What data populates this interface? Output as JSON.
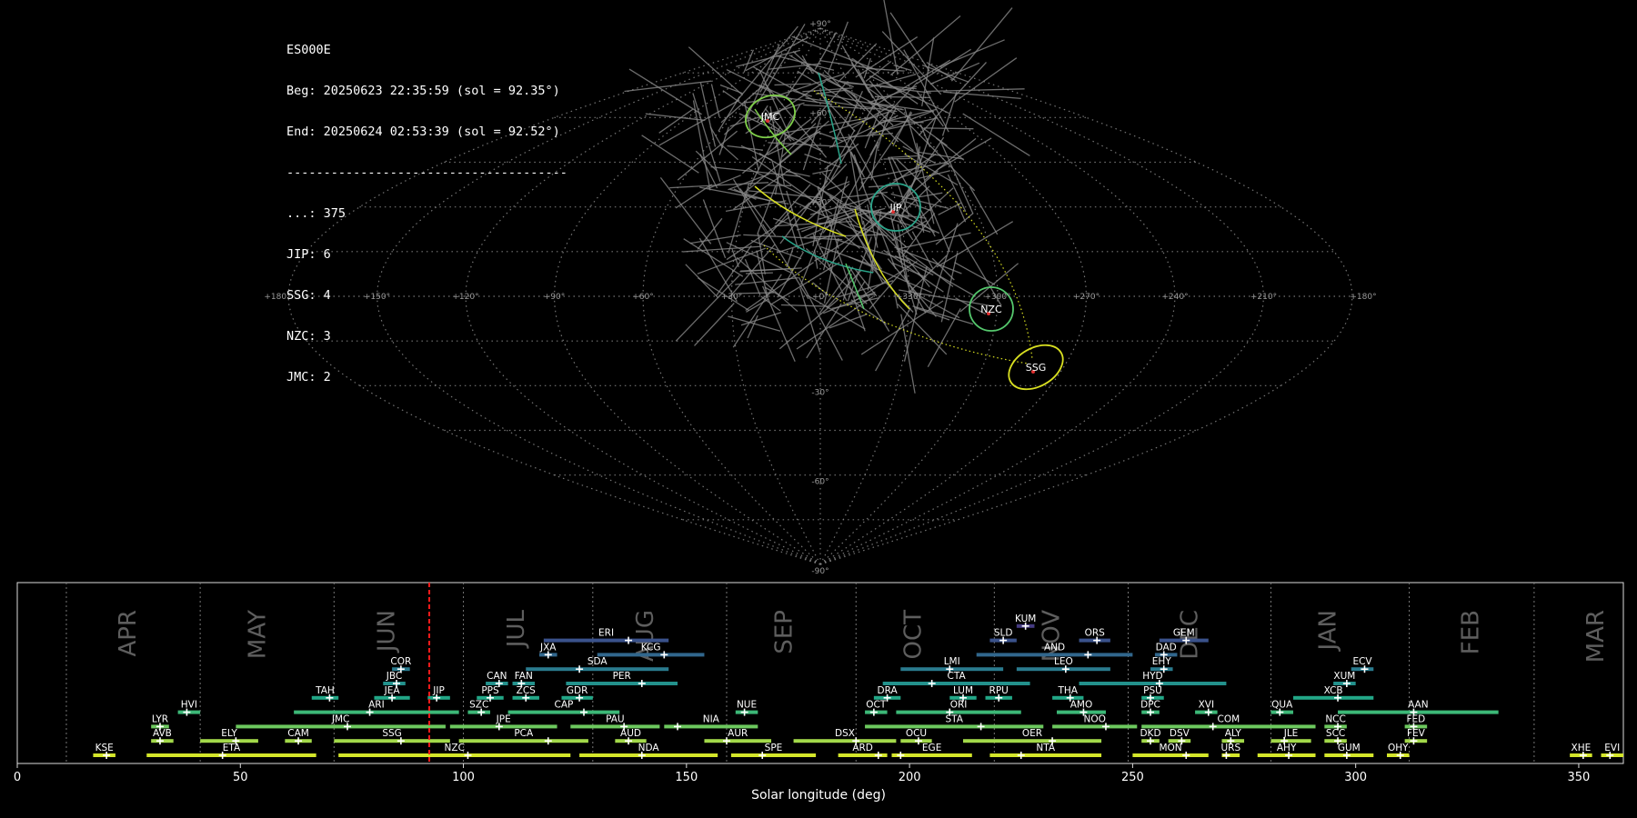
{
  "info": {
    "station": "ES000E",
    "begin": "Beg: 20250623 22:35:59 (sol = 92.35°)",
    "end": "End: 20250624 02:53:39 (sol = 92.52°)",
    "separator": "--------------------------------------",
    "counts": [
      {
        "label": "...: 375"
      },
      {
        "label": "JIP: 6"
      },
      {
        "label": "SSG: 4"
      },
      {
        "label": "NZC: 3"
      },
      {
        "label": "JMC: 2"
      }
    ]
  },
  "sky_map": {
    "projection": "sinusoidal",
    "lon_labels": [
      "+180°",
      "+150°",
      "+120°",
      "+90°",
      "+60°",
      "+30°",
      "+0°",
      "+330°",
      "+300°",
      "+270°",
      "+240°",
      "+210°",
      "+180°"
    ],
    "lat_labels": [
      "+90°",
      "+60°",
      "+30°",
      "+0°",
      "-30°",
      "-60°",
      "-90°"
    ],
    "showers": [
      {
        "code": "JMC",
        "color": "#7fcf4a"
      },
      {
        "code": "JIP",
        "color": "#2aa58a"
      },
      {
        "code": "NZC",
        "color": "#55c86d"
      },
      {
        "code": "SSG",
        "color": "#d9e021"
      }
    ],
    "sporadic_color": "#888888"
  },
  "chart_data": {
    "type": "timeline",
    "xlabel": "Solar longitude (deg)",
    "xlim": [
      0,
      360
    ],
    "xticks": [
      0,
      50,
      100,
      150,
      200,
      250,
      300,
      350
    ],
    "current_sol": 92.35,
    "months": [
      {
        "name": "APR",
        "sol": 25
      },
      {
        "name": "MAY",
        "sol": 54
      },
      {
        "name": "JUN",
        "sol": 83
      },
      {
        "name": "JUL",
        "sol": 112
      },
      {
        "name": "AUG",
        "sol": 141
      },
      {
        "name": "SEP",
        "sol": 172
      },
      {
        "name": "OCT",
        "sol": 201
      },
      {
        "name": "NOV",
        "sol": 232
      },
      {
        "name": "DEC",
        "sol": 263
      },
      {
        "name": "JAN",
        "sol": 294
      },
      {
        "name": "FEB",
        "sol": 326
      },
      {
        "name": "MAR",
        "sol": 354
      }
    ],
    "month_boundaries": [
      11,
      41,
      71,
      100,
      129,
      159,
      188,
      219,
      249,
      281,
      312,
      340
    ],
    "showers": [
      {
        "code": "KUM",
        "start": 224,
        "end": 228,
        "peak": 226,
        "row": 10
      },
      {
        "code": "ERI",
        "start": 118,
        "end": 146,
        "peak": 137,
        "row": 9
      },
      {
        "code": "SLD",
        "start": 218,
        "end": 224,
        "peak": 221,
        "row": 9
      },
      {
        "code": "ORS",
        "start": 238,
        "end": 245,
        "peak": 242,
        "row": 9
      },
      {
        "code": "GEM",
        "start": 256,
        "end": 267,
        "peak": 262,
        "row": 9
      },
      {
        "code": "JXA",
        "start": 117,
        "end": 121,
        "peak": 119,
        "row": 8
      },
      {
        "code": "KCG",
        "start": 130,
        "end": 154,
        "peak": 145,
        "row": 8
      },
      {
        "code": "AND",
        "start": 215,
        "end": 250,
        "peak": 240,
        "row": 8
      },
      {
        "code": "DAD",
        "start": 255,
        "end": 260,
        "peak": 257,
        "row": 8
      },
      {
        "code": "COR",
        "start": 84,
        "end": 88,
        "peak": 86,
        "row": 7
      },
      {
        "code": "SDA",
        "start": 114,
        "end": 146,
        "peak": 126,
        "row": 7
      },
      {
        "code": "LMI",
        "start": 198,
        "end": 221,
        "peak": 209,
        "row": 7
      },
      {
        "code": "LEO",
        "start": 224,
        "end": 245,
        "peak": 235,
        "row": 7
      },
      {
        "code": "EHY",
        "start": 254,
        "end": 259,
        "peak": 257,
        "row": 7
      },
      {
        "code": "ECV",
        "start": 299,
        "end": 304,
        "peak": 302,
        "row": 7
      },
      {
        "code": "JBC",
        "start": 82,
        "end": 87,
        "peak": 85,
        "row": 6
      },
      {
        "code": "CAN",
        "start": 105,
        "end": 110,
        "peak": 108,
        "row": 6
      },
      {
        "code": "FAN",
        "start": 111,
        "end": 116,
        "peak": 113,
        "row": 6
      },
      {
        "code": "PER",
        "start": 123,
        "end": 148,
        "peak": 140,
        "row": 6
      },
      {
        "code": "CTA",
        "start": 194,
        "end": 227,
        "peak": 205,
        "row": 6
      },
      {
        "code": "HYD",
        "start": 238,
        "end": 271,
        "peak": 256,
        "row": 6
      },
      {
        "code": "XUM",
        "start": 295,
        "end": 300,
        "peak": 298,
        "row": 6
      },
      {
        "code": "TAH",
        "start": 66,
        "end": 72,
        "peak": 70,
        "row": 5
      },
      {
        "code": "JEA",
        "start": 80,
        "end": 88,
        "peak": 84,
        "row": 5
      },
      {
        "code": "JIP",
        "start": 92,
        "end": 97,
        "peak": 94,
        "row": 5
      },
      {
        "code": "PPS",
        "start": 103,
        "end": 109,
        "peak": 106,
        "row": 5
      },
      {
        "code": "ZCS",
        "start": 111,
        "end": 117,
        "peak": 114,
        "row": 5
      },
      {
        "code": "GDR",
        "start": 122,
        "end": 129,
        "peak": 126,
        "row": 5
      },
      {
        "code": "DRA",
        "start": 192,
        "end": 198,
        "peak": 195,
        "row": 5
      },
      {
        "code": "LUM",
        "start": 209,
        "end": 215,
        "peak": 212,
        "row": 5
      },
      {
        "code": "RPU",
        "start": 217,
        "end": 223,
        "peak": 220,
        "row": 5
      },
      {
        "code": "THA",
        "start": 232,
        "end": 239,
        "peak": 236,
        "row": 5
      },
      {
        "code": "PSU",
        "start": 252,
        "end": 257,
        "peak": 254,
        "row": 5
      },
      {
        "code": "XCB",
        "start": 286,
        "end": 304,
        "peak": 296,
        "row": 5
      },
      {
        "code": "HVI",
        "start": 36,
        "end": 41,
        "peak": 38,
        "row": 4
      },
      {
        "code": "ARI",
        "start": 62,
        "end": 99,
        "peak": 79,
        "row": 4
      },
      {
        "code": "SZC",
        "start": 101,
        "end": 106,
        "peak": 104,
        "row": 4
      },
      {
        "code": "CAP",
        "start": 110,
        "end": 135,
        "peak": 127,
        "row": 4
      },
      {
        "code": "NUE",
        "start": 161,
        "end": 166,
        "peak": 163,
        "row": 4
      },
      {
        "code": "OCT",
        "start": 190,
        "end": 195,
        "peak": 192,
        "row": 4
      },
      {
        "code": "ORI",
        "start": 197,
        "end": 225,
        "peak": 209,
        "row": 4
      },
      {
        "code": "AMO",
        "start": 233,
        "end": 244,
        "peak": 239,
        "row": 4
      },
      {
        "code": "DPC",
        "start": 252,
        "end": 256,
        "peak": 254,
        "row": 4
      },
      {
        "code": "XVI",
        "start": 264,
        "end": 269,
        "peak": 267,
        "row": 4
      },
      {
        "code": "QUA",
        "start": 281,
        "end": 286,
        "peak": 283,
        "row": 4
      },
      {
        "code": "AAN",
        "start": 296,
        "end": 332,
        "peak": 313,
        "row": 4
      },
      {
        "code": "LYR",
        "start": 30,
        "end": 34,
        "peak": 32,
        "row": 3
      },
      {
        "code": "JMC",
        "start": 49,
        "end": 96,
        "peak": 74,
        "row": 3
      },
      {
        "code": "JPE",
        "start": 97,
        "end": 121,
        "peak": 108,
        "row": 3
      },
      {
        "code": "PAU",
        "start": 124,
        "end": 144,
        "peak": 136,
        "row": 3
      },
      {
        "code": "NIA",
        "start": 145,
        "end": 166,
        "peak": 148,
        "row": 3
      },
      {
        "code": "STA",
        "start": 190,
        "end": 230,
        "peak": 216,
        "row": 3
      },
      {
        "code": "NOO",
        "start": 232,
        "end": 251,
        "peak": 244,
        "row": 3
      },
      {
        "code": "COM",
        "start": 252,
        "end": 291,
        "peak": 268,
        "row": 3
      },
      {
        "code": "NCC",
        "start": 293,
        "end": 298,
        "peak": 296,
        "row": 3
      },
      {
        "code": "FED",
        "start": 311,
        "end": 316,
        "peak": 313,
        "row": 3
      },
      {
        "code": "AVB",
        "start": 30,
        "end": 35,
        "peak": 32,
        "row": 2
      },
      {
        "code": "ELY",
        "start": 41,
        "end": 54,
        "peak": 49,
        "row": 2
      },
      {
        "code": "CAM",
        "start": 60,
        "end": 66,
        "peak": 63,
        "row": 2
      },
      {
        "code": "SSG",
        "start": 71,
        "end": 97,
        "peak": 86,
        "row": 2
      },
      {
        "code": "PCA",
        "start": 99,
        "end": 128,
        "peak": 119,
        "row": 2
      },
      {
        "code": "AUD",
        "start": 134,
        "end": 141,
        "peak": 137,
        "row": 2
      },
      {
        "code": "AUR",
        "start": 154,
        "end": 169,
        "peak": 159,
        "row": 2
      },
      {
        "code": "DSX",
        "start": 174,
        "end": 197,
        "peak": 188,
        "row": 2
      },
      {
        "code": "OCU",
        "start": 198,
        "end": 205,
        "peak": 202,
        "row": 2
      },
      {
        "code": "OER",
        "start": 212,
        "end": 243,
        "peak": 232,
        "row": 2
      },
      {
        "code": "DKD",
        "start": 252,
        "end": 256,
        "peak": 254,
        "row": 2
      },
      {
        "code": "DSV",
        "start": 258,
        "end": 263,
        "peak": 261,
        "row": 2
      },
      {
        "code": "ALY",
        "start": 270,
        "end": 275,
        "peak": 272,
        "row": 2
      },
      {
        "code": "JLE",
        "start": 281,
        "end": 290,
        "peak": 284,
        "row": 2
      },
      {
        "code": "SCC",
        "start": 293,
        "end": 298,
        "peak": 296,
        "row": 2
      },
      {
        "code": "FEV",
        "start": 311,
        "end": 316,
        "peak": 313,
        "row": 2
      },
      {
        "code": "KSE",
        "start": 17,
        "end": 22,
        "peak": 20,
        "row": 1
      },
      {
        "code": "ETA",
        "start": 29,
        "end": 67,
        "peak": 46,
        "row": 1
      },
      {
        "code": "NZC",
        "start": 72,
        "end": 124,
        "peak": 101,
        "row": 1
      },
      {
        "code": "NDA",
        "start": 126,
        "end": 157,
        "peak": 140,
        "row": 1
      },
      {
        "code": "SPE",
        "start": 160,
        "end": 179,
        "peak": 167,
        "row": 1
      },
      {
        "code": "ARD",
        "start": 184,
        "end": 195,
        "peak": 193,
        "row": 1
      },
      {
        "code": "EGE",
        "start": 196,
        "end": 214,
        "peak": 198,
        "row": 1
      },
      {
        "code": "NTA",
        "start": 218,
        "end": 243,
        "peak": 225,
        "row": 1
      },
      {
        "code": "MON",
        "start": 250,
        "end": 267,
        "peak": 262,
        "row": 1
      },
      {
        "code": "URS",
        "start": 270,
        "end": 274,
        "peak": 271,
        "row": 1
      },
      {
        "code": "AHY",
        "start": 278,
        "end": 291,
        "peak": 285,
        "row": 1
      },
      {
        "code": "GUM",
        "start": 293,
        "end": 304,
        "peak": 298,
        "row": 1
      },
      {
        "code": "OHY",
        "start": 307,
        "end": 312,
        "peak": 310,
        "row": 1
      },
      {
        "code": "XHE",
        "start": 348,
        "end": 353,
        "peak": 351,
        "row": 1
      },
      {
        "code": "EVI",
        "start": 355,
        "end": 360,
        "peak": 357,
        "row": 1
      }
    ]
  }
}
